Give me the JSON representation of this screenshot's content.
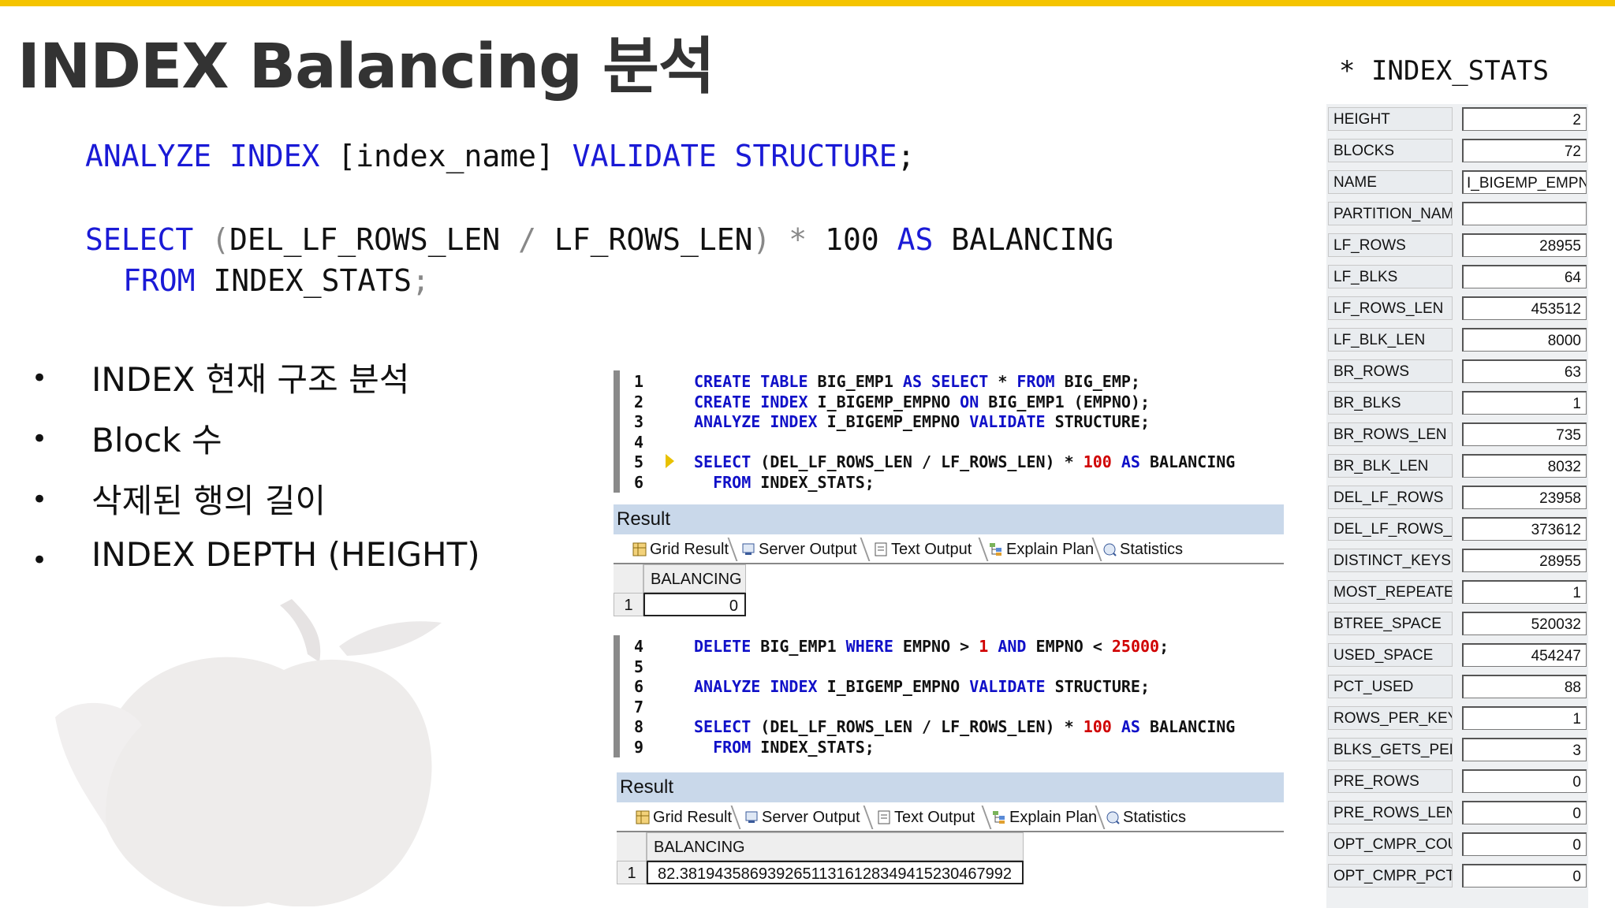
{
  "title": "INDEX Balancing 분석",
  "code": {
    "line1": {
      "kw1": "ANALYZE INDEX",
      "plain1": " [index_name] ",
      "kw2": "VALIDATE STRUCTURE",
      "plain2": ";"
    },
    "line2": {
      "kw1": "SELECT",
      "p1": " (",
      "t1": "DEL_LF_ROWS_LEN",
      "p2": " / ",
      "t2": "LF_ROWS_LEN",
      "p3": ")",
      "p4": " * ",
      "t3": "100",
      "kw2": " AS",
      "t4": " BALANCING"
    },
    "line3": {
      "kw1": "FROM",
      "t1": " INDEX_STATS",
      "p1": ";"
    }
  },
  "bullets": [
    "INDEX 현재 구조 분석",
    "Block 수",
    "삭제된 행의 길이",
    "INDEX DEPTH (HEIGHT)"
  ],
  "bullet_symbol": "•",
  "editor1": {
    "lines": [
      {
        "num": "1",
        "parts": [
          [
            "k",
            "CREATE TABLE"
          ],
          [
            "t",
            " BIG_EMP1 "
          ],
          [
            "k",
            "AS SELECT"
          ],
          [
            "t",
            " * "
          ],
          [
            "k",
            "FROM"
          ],
          [
            "t",
            " BIG_EMP;"
          ]
        ]
      },
      {
        "num": "2",
        "parts": [
          [
            "k",
            "CREATE INDEX"
          ],
          [
            "t",
            " I_BIGEMP_EMPNO "
          ],
          [
            "k",
            "ON"
          ],
          [
            "t",
            " BIG_EMP1 (EMPNO);"
          ]
        ]
      },
      {
        "num": "3",
        "parts": [
          [
            "k",
            "ANALYZE INDEX"
          ],
          [
            "t",
            " I_BIGEMP_EMPNO "
          ],
          [
            "k",
            "VALIDATE"
          ],
          [
            "t",
            " STRUCTURE;"
          ]
        ]
      },
      {
        "num": "4",
        "parts": []
      },
      {
        "num": "5",
        "parts": [
          [
            "k",
            "SELECT"
          ],
          [
            "t",
            " (DEL_LF_ROWS_LEN / LF_ROWS_LEN) * "
          ],
          [
            "n",
            "100"
          ],
          [
            "k",
            " AS"
          ],
          [
            "t",
            " BALANCING"
          ]
        ]
      },
      {
        "num": "6",
        "parts": [
          [
            "t",
            "  "
          ],
          [
            "k",
            "FROM"
          ],
          [
            "t",
            " INDEX_STATS;"
          ]
        ]
      }
    ]
  },
  "editor2": {
    "lines": [
      {
        "num": "4",
        "parts": [
          [
            "k",
            "DELETE"
          ],
          [
            "t",
            " BIG_EMP1 "
          ],
          [
            "k",
            "WHERE"
          ],
          [
            "t",
            " EMPNO > "
          ],
          [
            "n",
            "1"
          ],
          [
            "k",
            " AND"
          ],
          [
            "t",
            " EMPNO < "
          ],
          [
            "n",
            "25000"
          ],
          [
            "t",
            ";"
          ]
        ]
      },
      {
        "num": "5",
        "parts": []
      },
      {
        "num": "6",
        "parts": [
          [
            "k",
            "ANALYZE INDEX"
          ],
          [
            "t",
            " I_BIGEMP_EMPNO "
          ],
          [
            "k",
            "VALIDATE"
          ],
          [
            "t",
            " STRUCTURE;"
          ]
        ]
      },
      {
        "num": "7",
        "parts": []
      },
      {
        "num": "8",
        "parts": [
          [
            "k",
            "SELECT"
          ],
          [
            "t",
            " (DEL_LF_ROWS_LEN / LF_ROWS_LEN) * "
          ],
          [
            "n",
            "100"
          ],
          [
            "k",
            " AS"
          ],
          [
            "t",
            " BALANCING"
          ]
        ]
      },
      {
        "num": "9",
        "parts": [
          [
            "t",
            "  "
          ],
          [
            "k",
            "FROM"
          ],
          [
            "t",
            " INDEX_STATS;"
          ]
        ]
      }
    ]
  },
  "result1": {
    "header": "Result",
    "tabs": [
      "Grid Result",
      "Server Output",
      "Text Output",
      "Explain Plan",
      "Statistics"
    ],
    "column": "BALANCING",
    "row_num": "1",
    "value": "0"
  },
  "result2": {
    "header": "Result",
    "tabs": [
      "Grid Result",
      "Server Output",
      "Text Output",
      "Explain Plan",
      "Statistics"
    ],
    "column": "BALANCING",
    "row_num": "1",
    "value": "82.3819435869392651131612834941523046799​2"
  },
  "stats": {
    "title": "* INDEX_STATS",
    "rows": [
      {
        "label": "HEIGHT",
        "value": "2"
      },
      {
        "label": "BLOCKS",
        "value": "72"
      },
      {
        "label": "NAME",
        "value": "I_BIGEMP_EMPNC",
        "left": true
      },
      {
        "label": "PARTITION_NAM",
        "value": ""
      },
      {
        "label": "LF_ROWS",
        "value": "28955"
      },
      {
        "label": "LF_BLKS",
        "value": "64"
      },
      {
        "label": "LF_ROWS_LEN",
        "value": "453512"
      },
      {
        "label": "LF_BLK_LEN",
        "value": "8000"
      },
      {
        "label": "BR_ROWS",
        "value": "63"
      },
      {
        "label": "BR_BLKS",
        "value": "1"
      },
      {
        "label": "BR_ROWS_LEN",
        "value": "735"
      },
      {
        "label": "BR_BLK_LEN",
        "value": "8032"
      },
      {
        "label": "DEL_LF_ROWS",
        "value": "23958"
      },
      {
        "label": "DEL_LF_ROWS_L",
        "value": "373612"
      },
      {
        "label": "DISTINCT_KEYS",
        "value": "28955"
      },
      {
        "label": "MOST_REPEATEI",
        "value": "1"
      },
      {
        "label": "BTREE_SPACE",
        "value": "520032"
      },
      {
        "label": "USED_SPACE",
        "value": "454247"
      },
      {
        "label": "PCT_USED",
        "value": "88"
      },
      {
        "label": "ROWS_PER_KEY",
        "value": "1"
      },
      {
        "label": "BLKS_GETS_PER",
        "value": "3"
      },
      {
        "label": "PRE_ROWS",
        "value": "0"
      },
      {
        "label": "PRE_ROWS_LEN",
        "value": "0"
      },
      {
        "label": "OPT_CMPR_COUI",
        "value": "0"
      },
      {
        "label": "OPT_CMPR_PCTS",
        "value": "0"
      }
    ]
  },
  "colors": {
    "accent": "#f5c400",
    "keyword": "#1a1ad6",
    "number": "#d00000",
    "result_header": "#c9d8ea"
  }
}
